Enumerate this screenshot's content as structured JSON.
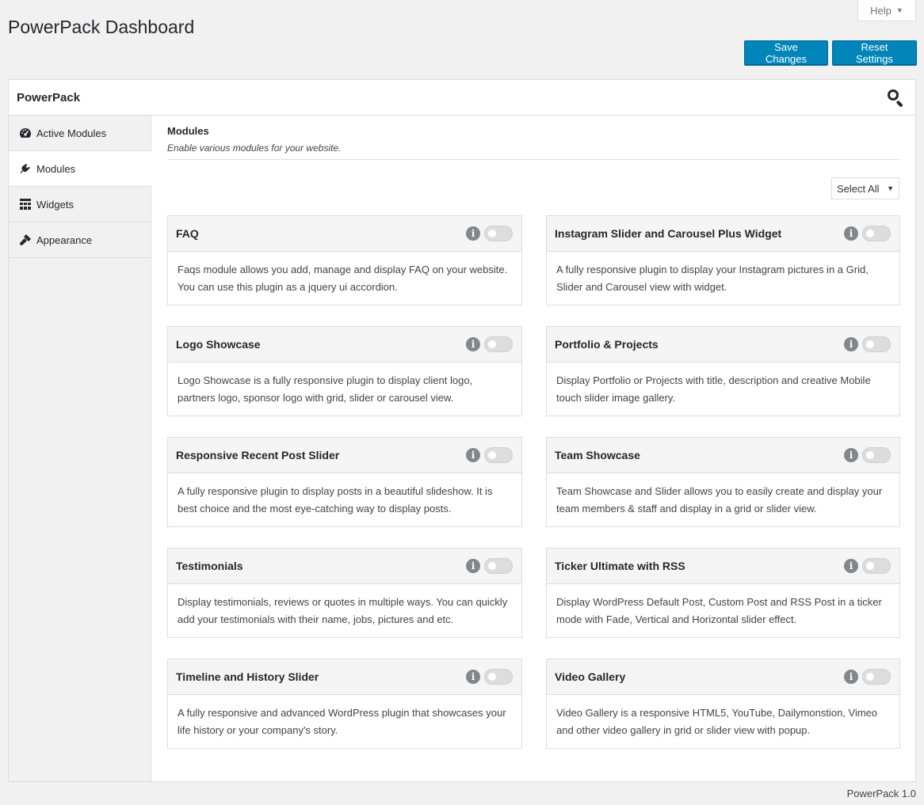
{
  "header": {
    "help_label": "Help",
    "page_title": "PowerPack Dashboard",
    "save_label": "Save Changes",
    "reset_label": "Reset Settings"
  },
  "panel": {
    "title": "PowerPack"
  },
  "sidebar": {
    "items": [
      {
        "label": "Active Modules",
        "icon": "dashboard-icon",
        "active": false
      },
      {
        "label": "Modules",
        "icon": "plugin-icon",
        "active": true
      },
      {
        "label": "Widgets",
        "icon": "widgets-icon",
        "active": false
      },
      {
        "label": "Appearance",
        "icon": "paintbrush-icon",
        "active": false
      }
    ]
  },
  "section": {
    "title": "Modules",
    "description": "Enable various modules for your website.",
    "select_all_label": "Select All"
  },
  "modules": [
    {
      "title": "FAQ",
      "description": "Faqs module allows you add, manage and display FAQ on your website. You can use this plugin as a jquery ui accordion.",
      "enabled": false
    },
    {
      "title": "Instagram Slider and Carousel Plus Widget",
      "description": "A fully responsive plugin to display your Instagram pictures in a Grid, Slider and Carousel view with widget.",
      "enabled": false
    },
    {
      "title": "Logo Showcase",
      "description": "Logo Showcase is a fully responsive plugin to display client logo, partners logo, sponsor logo with grid, slider or carousel view.",
      "enabled": false
    },
    {
      "title": "Portfolio & Projects",
      "description": "Display Portfolio or Projects with title, description and creative Mobile touch slider image gallery.",
      "enabled": false
    },
    {
      "title": "Responsive Recent Post Slider",
      "description": "A fully responsive plugin to display posts in a beautiful slideshow. It is best choice and the most eye-catching way to display posts.",
      "enabled": false
    },
    {
      "title": "Team Showcase",
      "description": "Team Showcase and Slider allows you to easily create and display your team members & staff and display in a grid or slider view.",
      "enabled": false
    },
    {
      "title": "Testimonials",
      "description": "Display testimonials, reviews or quotes in multiple ways. You can quickly add your testimonials with their name, jobs, pictures and etc.",
      "enabled": false
    },
    {
      "title": "Ticker Ultimate with RSS",
      "description": "Display WordPress Default Post, Custom Post and RSS Post in a ticker mode with Fade, Vertical and Horizontal slider effect.",
      "enabled": false
    },
    {
      "title": "Timeline and History Slider",
      "description": "A fully responsive and advanced WordPress plugin that showcases your life history or your company's story.",
      "enabled": false
    },
    {
      "title": "Video Gallery",
      "description": "Video Gallery is a responsive HTML5, YouTube, Dailymonstion, Vimeo and other video gallery in grid or slider view with popup.",
      "enabled": false
    }
  ],
  "footer": {
    "version": "PowerPack 1.0"
  },
  "colors": {
    "primary_button": "#0085ba",
    "background": "#f1f1f1",
    "toggle_off": "#dddddd"
  }
}
